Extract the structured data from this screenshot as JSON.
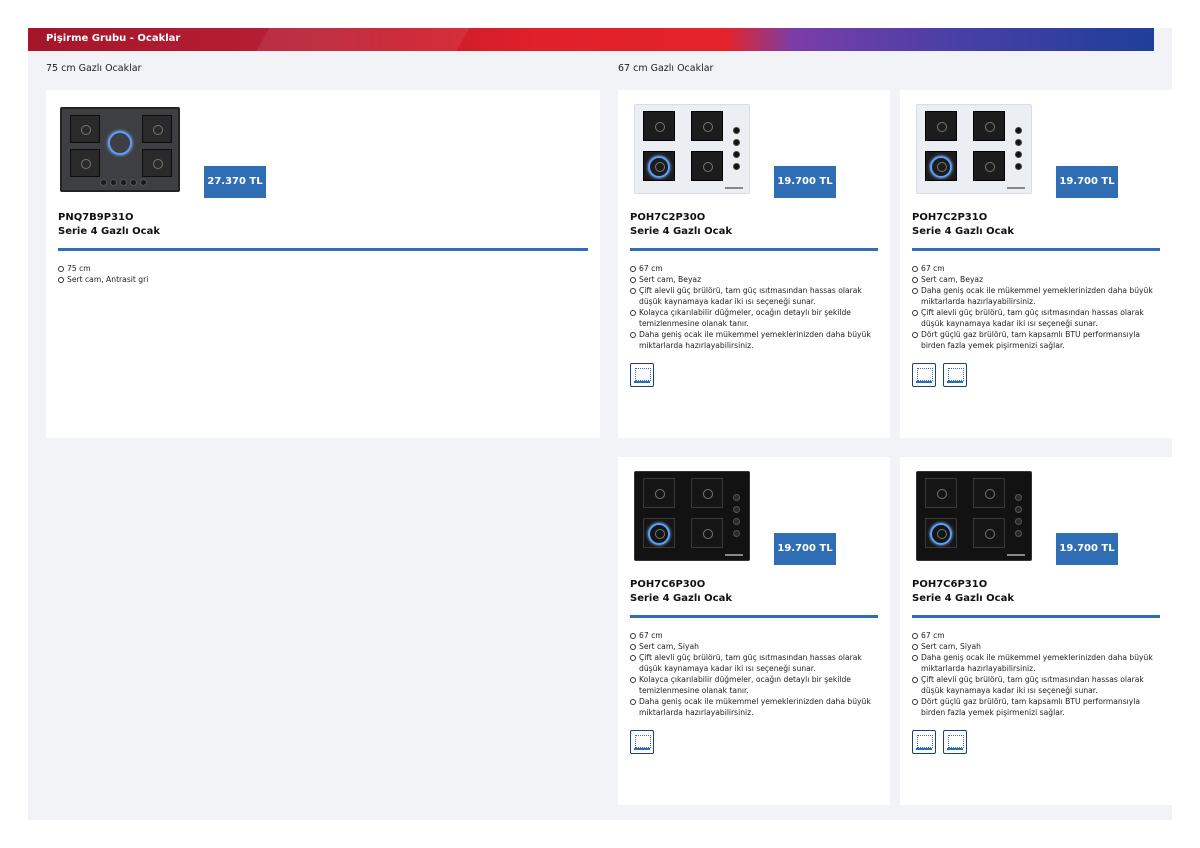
{
  "banner": {
    "title": "Pişirme Grubu - Ocaklar"
  },
  "sections": {
    "left_label": "75 cm Gazlı Ocaklar",
    "right_label": "67 cm Gazlı Ocaklar"
  },
  "products": [
    {
      "model": "PNQ7B9P31O",
      "serie": "Serie 4 Gazlı Ocak",
      "price": "27.370 TL",
      "features": [
        "75 cm",
        "Sert cam, Antrasit gri"
      ],
      "badges": [],
      "image": "antrasit-glass-hob-image"
    },
    {
      "model": "POH7C2P30O",
      "serie": "Serie 4 Gazlı Ocak",
      "price": "19.700 TL",
      "features": [
        "67 cm",
        "Sert cam, Beyaz",
        "Çift alevli güç brülörü, tam güç ısıtmasından hassas olarak düşük kaynamaya kadar iki ısı seçeneği sunar.",
        "Kolayca çıkarılabilir düğmeler, ocağın detaylı bir şekilde temizlenmesine olanak tanır.",
        "Daha geniş ocak ile mükemmel yemeklerinizden daha büyük miktarlarda hazırlayabilirsiniz."
      ],
      "badges": [
        "feature-badge-icon"
      ],
      "image": "white-glass-hob-image"
    },
    {
      "model": "POH7C2P31O",
      "serie": "Serie 4 Gazlı Ocak",
      "price": "19.700 TL",
      "features": [
        "67 cm",
        "Sert cam, Beyaz",
        "Daha geniş ocak ile mükemmel yemeklerinizden daha büyük miktarlarda hazırlayabilirsiniz.",
        "Çift alevli güç brülörü, tam güç ısıtmasından hassas olarak düşük kaynamaya kadar iki ısı seçeneği sunar.",
        "Dört güçlü gaz brülörü, tam kapsamlı BTU performansıyla birden fazla yemek pişirmenizi sağlar."
      ],
      "badges": [
        "feature-badge-icon",
        "feature-badge-icon"
      ],
      "image": "white-glass-hob-image"
    },
    {
      "model": "POH7C6P30O",
      "serie": "Serie 4 Gazlı Ocak",
      "price": "19.700 TL",
      "features": [
        "67 cm",
        "Sert cam, Siyah",
        "Çift alevli güç brülörü, tam güç ısıtmasından hassas olarak düşük kaynamaya kadar iki ısı seçeneği sunar.",
        "Kolayca çıkarılabilir düğmeler, ocağın detaylı bir şekilde temizlenmesine olanak tanır.",
        "Daha geniş ocak ile mükemmel yemeklerinizden daha büyük miktarlarda hazırlayabilirsiniz."
      ],
      "badges": [
        "feature-badge-icon"
      ],
      "image": "black-glass-hob-image"
    },
    {
      "model": "POH7C6P31O",
      "serie": "Serie 4 Gazlı Ocak",
      "price": "19.700 TL",
      "features": [
        "67 cm",
        "Sert cam, Siyah",
        "Daha geniş ocak ile mükemmel yemeklerinizden daha büyük miktarlarda hazırlayabilirsiniz.",
        "Çift alevli güç brülörü, tam güç ısıtmasından hassas olarak düşük kaynamaya kadar iki ısı seçeneği sunar.",
        "Dört güçlü gaz brülörü, tam kapsamlı BTU performansıyla birden fazla yemek pişirmenizi sağlar."
      ],
      "badges": [
        "feature-badge-icon",
        "feature-badge-icon"
      ],
      "image": "black-glass-hob-image"
    }
  ],
  "colors": {
    "accent_blue": "#2f6eb5",
    "banner_red": "#e4232a",
    "banner_purple": "#7a3da8",
    "banner_navy": "#1e3f9a"
  }
}
